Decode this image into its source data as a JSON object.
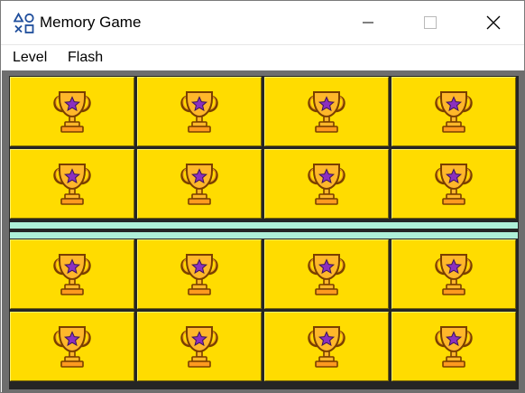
{
  "window": {
    "title": "Memory Game",
    "controls": [
      "minimize",
      "maximize",
      "close"
    ]
  },
  "menu": {
    "level_label": "Level",
    "flash_label": "Flash"
  },
  "board": {
    "card_icon": "trophy-star-icon",
    "card_state": "face-down",
    "card_color": "#ffdc00",
    "divider_color": "#aef0d8",
    "top_rows": 2,
    "bottom_rows": 2,
    "columns": 4
  }
}
